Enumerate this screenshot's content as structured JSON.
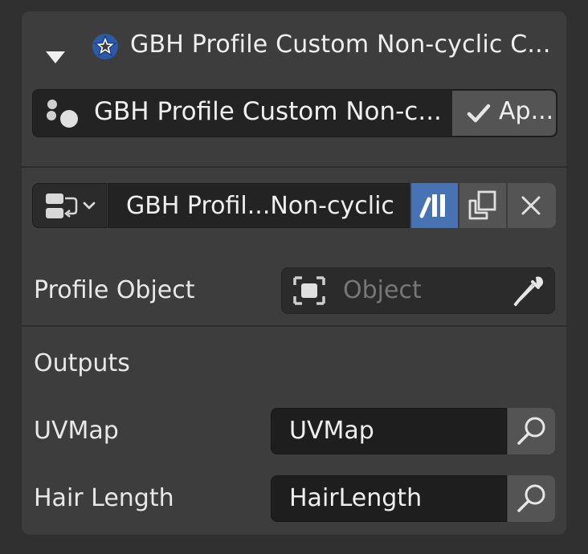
{
  "header": {
    "title": "GBH Profile Custom Non-cyclic C...",
    "collapse_icon": "triangle-down-icon",
    "modifier_icon": "geometry-nodes-star-icon"
  },
  "modifier": {
    "name": "GBH Profile Custom Non-c...",
    "apply_label": "Ap...",
    "icon": "node-tree-dots-icon"
  },
  "node_group": {
    "name": "GBH Profil...Non-cyclic",
    "browse_icon": "node-group-browse-icon",
    "fake_user_icon": "fake-user-icon",
    "duplicate_icon": "duplicate-icon",
    "unlink_icon": "close-icon"
  },
  "inputs": {
    "profile_object_label": "Profile Object",
    "profile_object_placeholder": "Object"
  },
  "outputs": {
    "section_label": "Outputs",
    "items": [
      {
        "label": "UVMap",
        "value": "UVMap"
      },
      {
        "label": "Hair Length",
        "value": "HairLength"
      }
    ]
  },
  "colors": {
    "panel_bg": "#3d3d3d",
    "field_bg": "#1e1e1e",
    "button_bg": "#545454",
    "accent": "#4772b3"
  }
}
